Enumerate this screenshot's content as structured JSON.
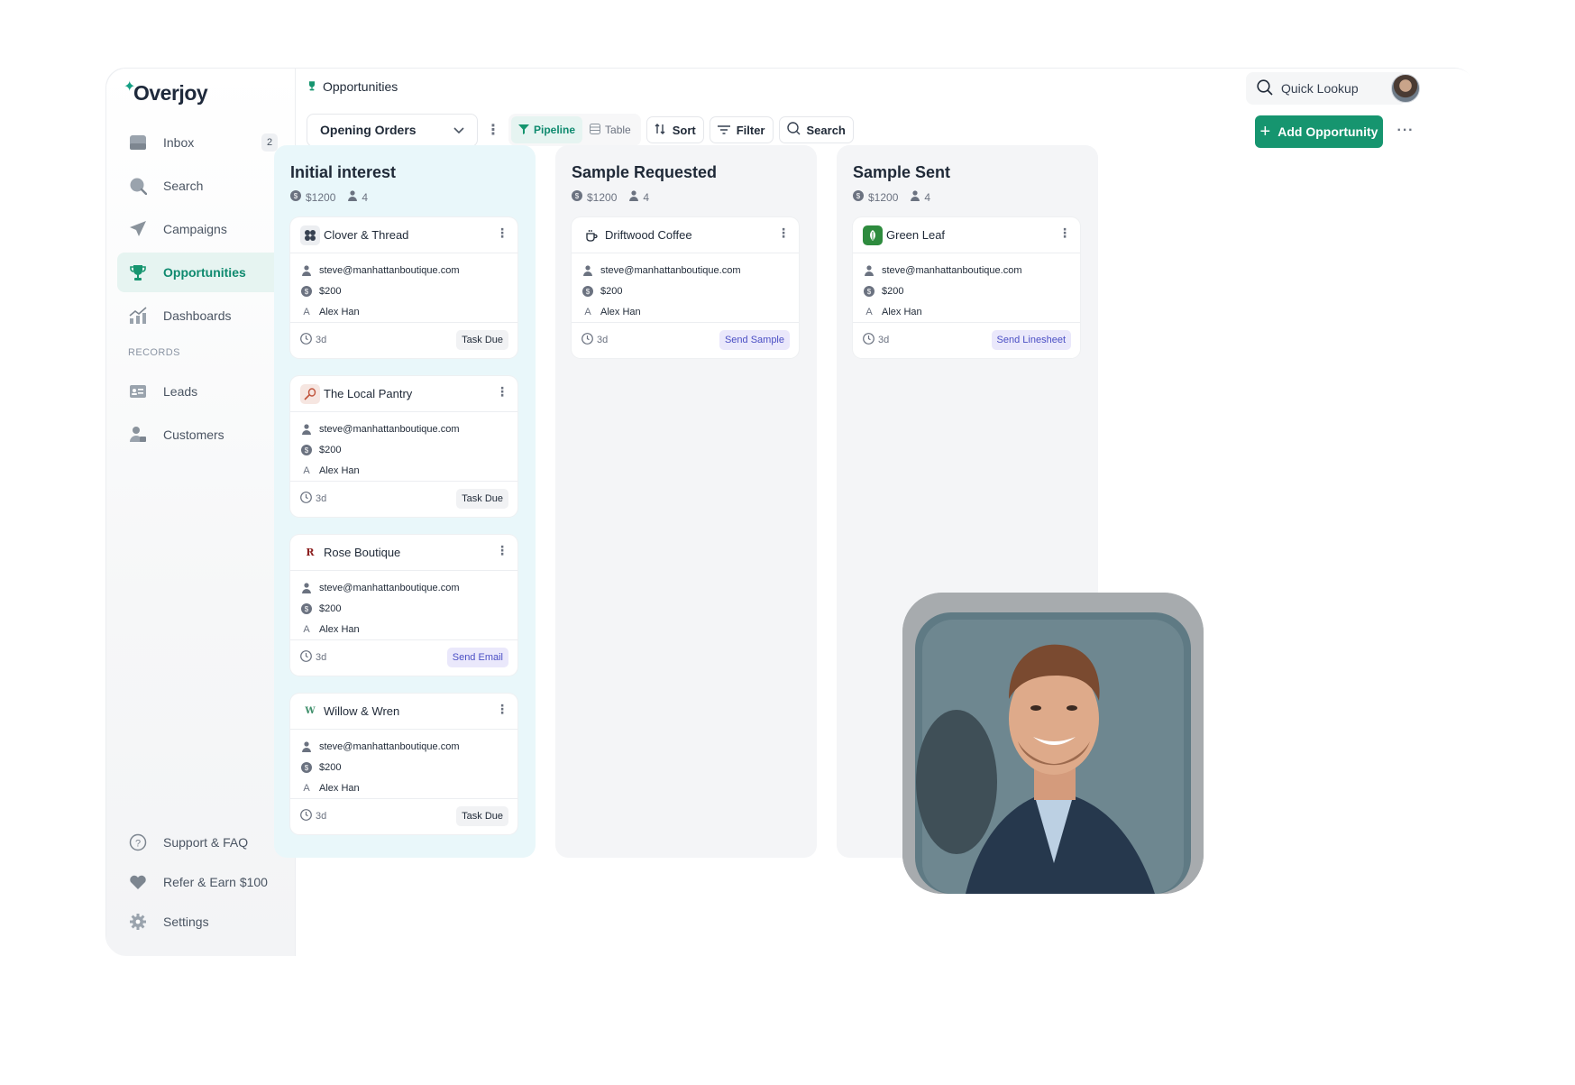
{
  "app": {
    "name": "Overjoy"
  },
  "sidebar": {
    "items": [
      {
        "label": "Inbox",
        "icon": "inbox-icon",
        "badge": "2"
      },
      {
        "label": "Search",
        "icon": "search-icon"
      },
      {
        "label": "Campaigns",
        "icon": "send-icon"
      },
      {
        "label": "Opportunities",
        "icon": "trophy-icon",
        "active": true
      },
      {
        "label": "Dashboards",
        "icon": "chart-icon"
      }
    ],
    "records_label": "RECORDS",
    "records": [
      {
        "label": "Leads",
        "icon": "id-card-icon"
      },
      {
        "label": "Customers",
        "icon": "customers-icon"
      }
    ],
    "bottom": [
      {
        "label": "Support & FAQ",
        "icon": "help-icon"
      },
      {
        "label": "Refer & Earn $100",
        "icon": "heart-icon"
      },
      {
        "label": "Settings",
        "icon": "gear-icon"
      }
    ]
  },
  "header": {
    "breadcrumb": "Opportunities",
    "view_select": "Opening Orders",
    "views": [
      "Pipeline",
      "Table"
    ],
    "active_view": "Pipeline",
    "sort_label": "Sort",
    "filter_label": "Filter",
    "search_label": "Search",
    "quick_lookup": "Quick Lookup",
    "add_button": "Add Opportunity"
  },
  "colors": {
    "accent": "#16956f",
    "accent_light": "#e6f4f1",
    "highlight_column": "#e9f7fa",
    "action_tag": "#eae8fb"
  },
  "columns": [
    {
      "title": "Initial interest",
      "amount": "$1200",
      "count": "4",
      "cards": [
        {
          "name": "Clover & Thread",
          "logo": "clover-logo-icon",
          "email": "steve@manhattanboutique.com",
          "value": "$200",
          "owner": "Alex Han",
          "owner_initial": "A",
          "age": "3d",
          "tag": "Task Due",
          "tag_type": "task"
        },
        {
          "name": "The Local Pantry",
          "logo": "pantry-logo-icon",
          "email": "steve@manhattanboutique.com",
          "value": "$200",
          "owner": "Alex Han",
          "owner_initial": "A",
          "age": "3d",
          "tag": "Task Due",
          "tag_type": "task"
        },
        {
          "name": "Rose Boutique",
          "logo": "rose-logo-icon",
          "logo_letter": "R",
          "email": "steve@manhattanboutique.com",
          "value": "$200",
          "owner": "Alex Han",
          "owner_initial": "A",
          "age": "3d",
          "tag": "Send Email",
          "tag_type": "action"
        },
        {
          "name": "Willow & Wren",
          "logo": "willow-logo-icon",
          "logo_letter": "W",
          "email": "steve@manhattanboutique.com",
          "value": "$200",
          "owner": "Alex Han",
          "owner_initial": "A",
          "age": "3d",
          "tag": "Task Due",
          "tag_type": "task"
        }
      ]
    },
    {
      "title": "Sample Requested",
      "amount": "$1200",
      "count": "4",
      "cards": [
        {
          "name": "Driftwood Coffee",
          "logo": "coffee-logo-icon",
          "email": "steve@manhattanboutique.com",
          "value": "$200",
          "owner": "Alex Han",
          "owner_initial": "A",
          "age": "3d",
          "tag": "Send Sample",
          "tag_type": "action"
        }
      ]
    },
    {
      "title": "Sample Sent",
      "amount": "$1200",
      "count": "4",
      "cards": [
        {
          "name": "Green Leaf",
          "logo": "leaf-logo-icon",
          "email": "steve@manhattanboutique.com",
          "value": "$200",
          "owner": "Alex Han",
          "owner_initial": "A",
          "age": "3d",
          "tag": "Send Linesheet",
          "tag_type": "action"
        }
      ]
    }
  ]
}
